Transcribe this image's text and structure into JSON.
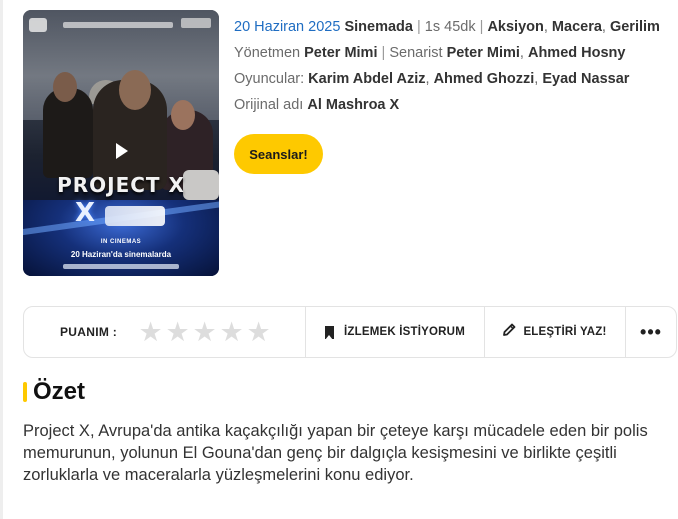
{
  "movie": {
    "release_date": "20 Haziran 2025",
    "status": "Sinemada",
    "duration": "1s 45dk",
    "genres": [
      "Aksiyon",
      "Macera",
      "Gerilim"
    ],
    "director_label": "Yönetmen",
    "director": "Peter Mimi",
    "writer_label": "Senarist",
    "writers": [
      "Peter Mimi",
      "Ahmed Hosny"
    ],
    "cast_label": "Oyuncular:",
    "cast": [
      "Karim Abdel Aziz",
      "Ahmed Ghozzi",
      "Eyad Nassar"
    ],
    "original_title_label": "Orijinal adı",
    "original_title": "Al Mashroa X"
  },
  "poster": {
    "title": "PROJECT X",
    "x_mark": "X",
    "in_cinemas": "IN CINEMAS",
    "date_line": "20 Haziran'da sinemalarda",
    "play_icon": "play-icon"
  },
  "buttons": {
    "showtimes": "Seanslar!"
  },
  "action_bar": {
    "rating_label": "PUANIM :",
    "stars": [
      "★",
      "★",
      "★",
      "★",
      "★"
    ],
    "user_rating": 0,
    "watchlist_label": "İZLEMEK İSTİYORUM",
    "review_label": "ELEŞTİRİ YAZ!",
    "more_label": "•••"
  },
  "summary": {
    "title": "Özet",
    "text": "Project X, Avrupa'da antika kaçakçılığı yapan bir çeteye karşı mücadele eden bir polis memurunun, yolunun El Gouna'dan genç bir dalgıçla kesişmesini ve birlikte çeşitli zorluklarla ve maceralarla yüzleşmelerini konu ediyor."
  },
  "colors": {
    "accent": "#fec900",
    "date_link": "#1f6dc2",
    "star_empty": "#dddddd"
  }
}
